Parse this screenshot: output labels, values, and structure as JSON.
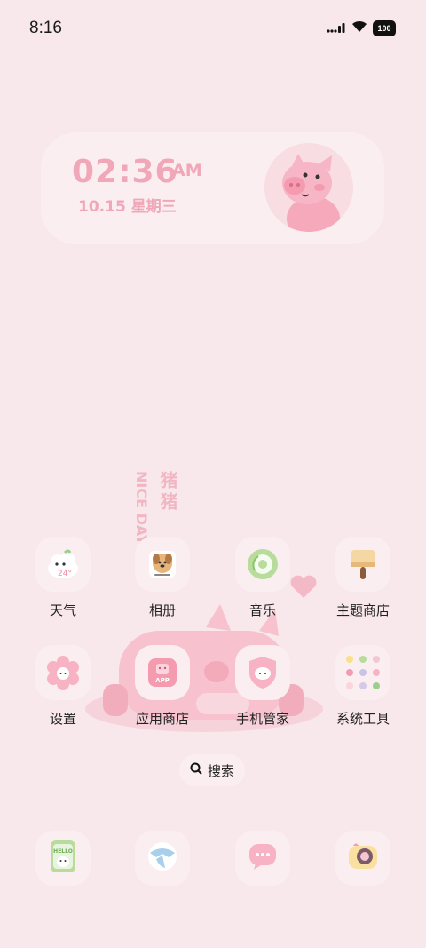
{
  "status_bar": {
    "time": "8:16",
    "battery": "100"
  },
  "clock_widget": {
    "time": "02:36",
    "ampm": "AM",
    "date": "10.15 星期三"
  },
  "decor": {
    "vertical_label_en": "NICE DAY",
    "vertical_label_cn": "猪猪"
  },
  "apps": [
    {
      "label": "天气",
      "icon": "weather-icon"
    },
    {
      "label": "相册",
      "icon": "gallery-icon"
    },
    {
      "label": "音乐",
      "icon": "music-icon"
    },
    {
      "label": "主题商店",
      "icon": "theme-store-icon"
    },
    {
      "label": "设置",
      "icon": "settings-icon"
    },
    {
      "label": "应用商店",
      "icon": "app-store-icon"
    },
    {
      "label": "手机管家",
      "icon": "phone-manager-icon"
    },
    {
      "label": "系统工具",
      "icon": "system-tools-folder-icon"
    }
  ],
  "weather_temp": "24°",
  "app_store_badge": "APP",
  "search": {
    "label": "搜索"
  },
  "dock": [
    {
      "icon": "phone-contacts-icon",
      "text": "HELLO"
    },
    {
      "icon": "browser-icon"
    },
    {
      "icon": "messages-icon"
    },
    {
      "icon": "camera-icon"
    }
  ],
  "colors": {
    "background": "#f8e7eb",
    "accent_pink": "#f0a7b8",
    "icon_bg": "#fbeef1"
  }
}
